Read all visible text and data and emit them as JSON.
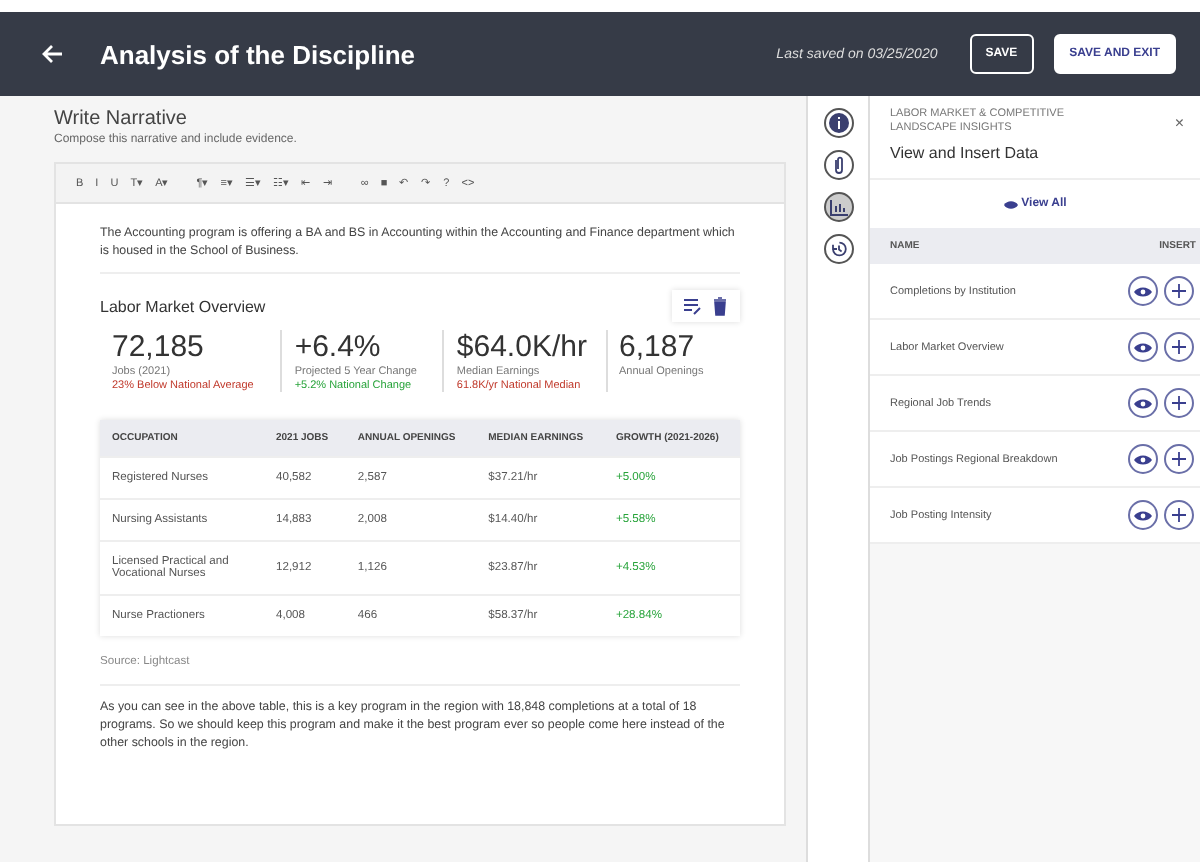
{
  "header": {
    "title": "Analysis of the Discipline",
    "last_saved": "Last saved on 03/25/2020",
    "buttons": [
      {
        "label": "SAVE",
        "kind": "outline"
      },
      {
        "label": "SAVE AND EXIT",
        "kind": "solid"
      }
    ]
  },
  "narrative": {
    "title": "Write Narrative",
    "subtitle": "Compose this narrative and include evidence.",
    "toolbar": [
      [
        "B",
        "I",
        "U",
        "T▾",
        "A▾"
      ],
      [
        "¶▾",
        "≡▾",
        "☰▾",
        "☷▾",
        "⇤",
        "⇥"
      ],
      [
        "∞",
        "■",
        "↶",
        "↷",
        "?",
        "<>"
      ]
    ],
    "intro": "The Accounting program is offering a BA and BS in Accounting within the Accounting and Finance department which is housed in the School of Business.",
    "overview": {
      "title": "Labor Market Overview",
      "stats": [
        {
          "value": "72,185",
          "label": "Jobs (2021)",
          "note": "23% Below National Average",
          "kind": "negative"
        },
        {
          "value": "+6.4%",
          "label": "Projected 5 Year Change",
          "note": "+5.2% National Change",
          "kind": "positive"
        },
        {
          "value": "$64.0K/hr",
          "label": "Median Earnings",
          "note": "61.8K/yr National Median",
          "kind": "negative"
        },
        {
          "value": "6,187",
          "label": "Annual Openings"
        }
      ]
    },
    "table": {
      "columns": [
        "OCCUPATION",
        "2021 JOBS",
        "ANNUAL OPENINGS",
        "MEDIAN EARNINGS",
        "GROWTH (2021-2026)"
      ],
      "rows": [
        [
          "Registered Nurses",
          "40,582",
          "2,587",
          "$37.21/hr",
          "+5.00%"
        ],
        [
          "Nursing Assistants",
          "14,883",
          "2,008",
          "$14.40/hr",
          "+5.58%"
        ],
        [
          "Licensed Practical and Vocational Nurses",
          "12,912",
          "1,126",
          "$23.87/hr",
          "+4.53%"
        ],
        [
          "Nurse Practioners",
          "4,008",
          "466",
          "$58.37/hr",
          "+28.84%"
        ]
      ]
    },
    "source": "Source: Lightcast",
    "conclusion": "As you can see in the above table, this is a key program in the region with 18,848 completions at a total of 18 programs. So we should keep this program and make it the best program ever so people come here instead of the other schools in the region."
  },
  "rail": [
    {
      "kind": "info",
      "selected": false
    },
    {
      "kind": "attachment",
      "selected": false
    },
    {
      "kind": "chart",
      "selected": true
    },
    {
      "kind": "history",
      "selected": false
    }
  ],
  "panel": {
    "eyebrow": "LABOR MARKET & COMPETITIVE LANDSCAPE INSIGHTS",
    "close": "×",
    "title": "View and Insert Data",
    "view_all": "View All",
    "columns": [
      "NAME",
      "INSERT"
    ],
    "items": [
      "Completions by Institution",
      "Labor Market Overview",
      "Regional Job Trends",
      "Job Postings Regional Breakdown",
      "Job Posting Intensity"
    ]
  }
}
